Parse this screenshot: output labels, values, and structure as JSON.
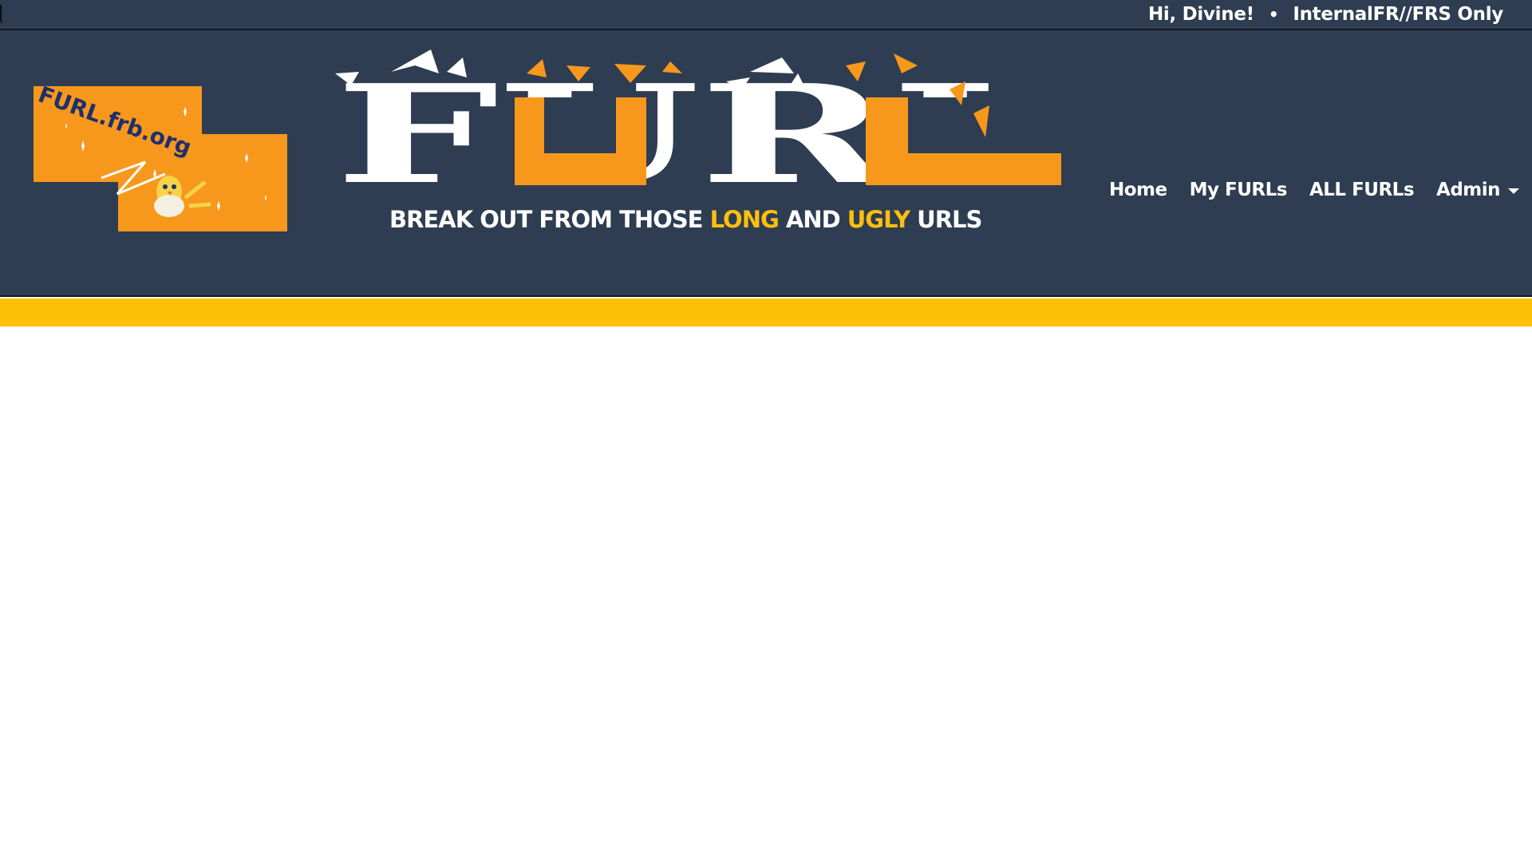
{
  "user_bar": {
    "greeting": "Hi, Divine!",
    "separator": "•",
    "classification": "InternalFR//FRS Only"
  },
  "logo": {
    "text": "FURL.frb.org",
    "icon": "chick-in-egg-icon"
  },
  "banner": {
    "title": "FURL",
    "tagline_part1": "BREAK OUT FROM THOSE ",
    "tagline_long": "LONG",
    "tagline_part2": " AND ",
    "tagline_ugly": "UGLY",
    "tagline_part3": " URLS"
  },
  "nav": {
    "items": [
      {
        "label": "Home"
      },
      {
        "label": "My FURLs"
      },
      {
        "label": "ALL FURLs"
      },
      {
        "label": "Admin"
      }
    ]
  },
  "colors": {
    "header_bg": "#2e3d51",
    "accent_orange": "#f7981d",
    "stripe_yellow": "#fdc205"
  }
}
